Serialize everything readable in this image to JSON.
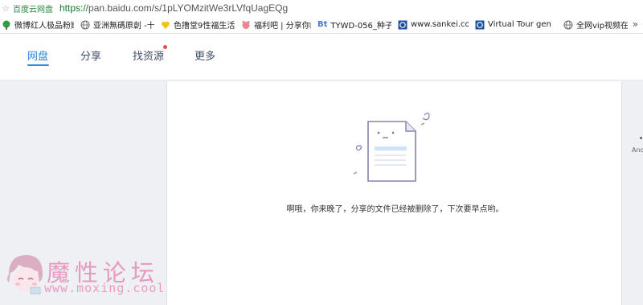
{
  "address_bar": {
    "site_name": "百度云网盘",
    "url_scheme": "https://",
    "url_rest": "pan.baidu.com/s/1pLYOMzitWe3rLVfqUagEQg"
  },
  "bookmarks": [
    {
      "label": "微博红人极品粉嫩",
      "icon": "tree-icon"
    },
    {
      "label": "亚洲無碼原創 -十四",
      "icon": "globe-icon"
    },
    {
      "label": "色撸堂9性福生活",
      "icon": "heart-icon"
    },
    {
      "label": "福利吧 | 分享你的",
      "icon": "pig-icon"
    },
    {
      "label": "TYWD-056_种子下",
      "icon": "bt-icon"
    },
    {
      "label": "www.sankei.com",
      "icon": "sankei-icon"
    },
    {
      "label": "Virtual Tour gen",
      "icon": "sankei-icon"
    },
    {
      "label": "全网vip视频在线解",
      "icon": "globe-icon"
    }
  ],
  "nav": {
    "items": [
      {
        "label": "网盘",
        "active": true
      },
      {
        "label": "分享",
        "active": false
      },
      {
        "label": "找资源",
        "active": false,
        "has_notification_dot": true
      },
      {
        "label": "更多",
        "active": false
      }
    ]
  },
  "content": {
    "message": "啊哦，你来晚了，分享的文件已经被删除了，下次要早点哟。"
  },
  "right_edge_label": "And",
  "watermark": {
    "title": "魔性论坛",
    "url": "www.moxing.cool"
  },
  "colors": {
    "accent": "#2a8ae5",
    "notification_dot": "#f04b4b",
    "watermark": "#e99ac0"
  }
}
